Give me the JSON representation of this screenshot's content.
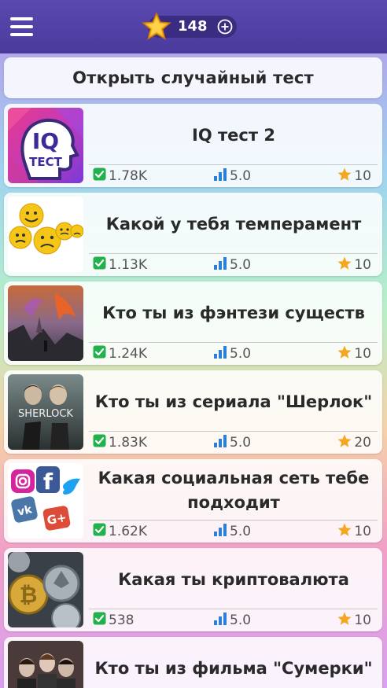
{
  "header": {
    "score": "148",
    "menu_icon": "hamburger-menu-icon",
    "star_icon": "star-icon",
    "plus_icon": "plus-circle-icon",
    "bar_color": "#4a3a9c"
  },
  "random_test_label": "Открыть случайный тест",
  "tests": [
    {
      "title": "IQ тест 2",
      "plays": "1.78K",
      "rating": "5.0",
      "points": "10",
      "thumb": "iq-head"
    },
    {
      "title": "Какой у тебя темперамент",
      "plays": "1.13K",
      "rating": "5.0",
      "points": "10",
      "thumb": "smileys"
    },
    {
      "title": "Кто ты из фэнтези существ",
      "plays": "1.24K",
      "rating": "5.0",
      "points": "10",
      "thumb": "fantasy-dragon"
    },
    {
      "title": "Кто ты из сериала \"Шерлок\"",
      "plays": "1.83K",
      "rating": "5.0",
      "points": "20",
      "thumb": "sherlock-poster",
      "thumb_text": "SHERLOCK"
    },
    {
      "title": "Какая социальная сеть тебе подходит",
      "plays": "1.62K",
      "rating": "5.0",
      "points": "10",
      "thumb": "social-icons"
    },
    {
      "title": "Какая ты криптовалюта",
      "plays": "538",
      "rating": "5.0",
      "points": "10",
      "thumb": "crypto-coins"
    },
    {
      "title": "Кто ты из фильма \"Сумерки\"",
      "plays": "",
      "rating": "",
      "points": "",
      "thumb": "twilight-poster"
    }
  ],
  "colors": {
    "check_green": "#22b14c",
    "chart_blue": "#2a7fd8",
    "star_orange": "#f5a623"
  }
}
